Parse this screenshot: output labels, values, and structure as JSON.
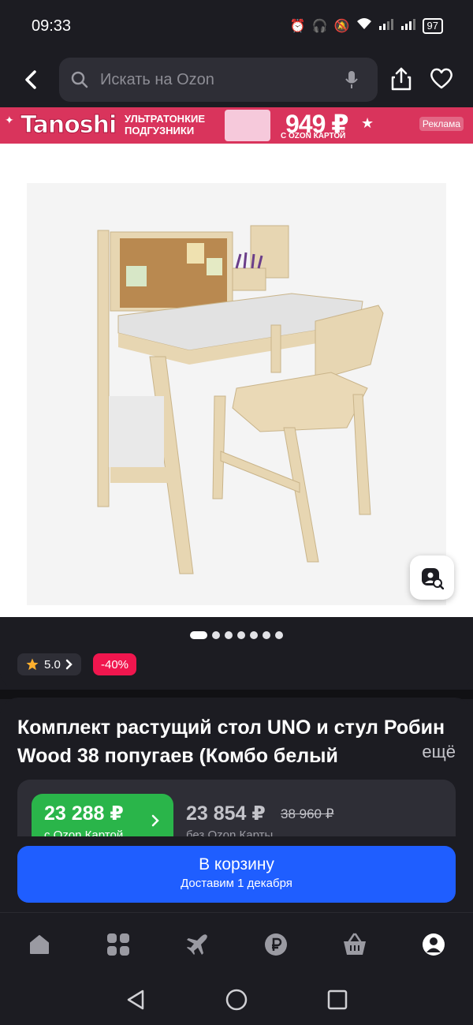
{
  "status": {
    "time": "09:33",
    "battery": "97"
  },
  "search": {
    "placeholder": "Искать на Ozon"
  },
  "banner": {
    "brand": "Tanoshi",
    "tagline_1": "УЛЬТРАТОНКИЕ",
    "tagline_2": "ПОДГУЗНИКИ",
    "price": "949 ₽",
    "price_note": "С OZON КАРТОЙ",
    "ad_label": "Реклама"
  },
  "gallery": {
    "slides": 7,
    "active": 0
  },
  "product": {
    "rating": "5.0",
    "discount": "-40%",
    "title": "Комплект растущий стол UNO и стул Робин Wood 38 попугаев (Комбо белый",
    "more_label": "ещё"
  },
  "pricing": {
    "ozon_price": "23 288 ₽",
    "ozon_label": "с Ozon Картой",
    "regular_price": "23 854 ₽",
    "old_price": "38 960 ₽",
    "regular_label": "без Ozon Карты"
  },
  "cart": {
    "label": "В корзину",
    "delivery": "Доставим 1 декабря"
  },
  "colors": {
    "accent": "#1f5eff",
    "ozon_green": "#2ab54a",
    "discount": "#f0164e",
    "background": "#1c1c22"
  }
}
